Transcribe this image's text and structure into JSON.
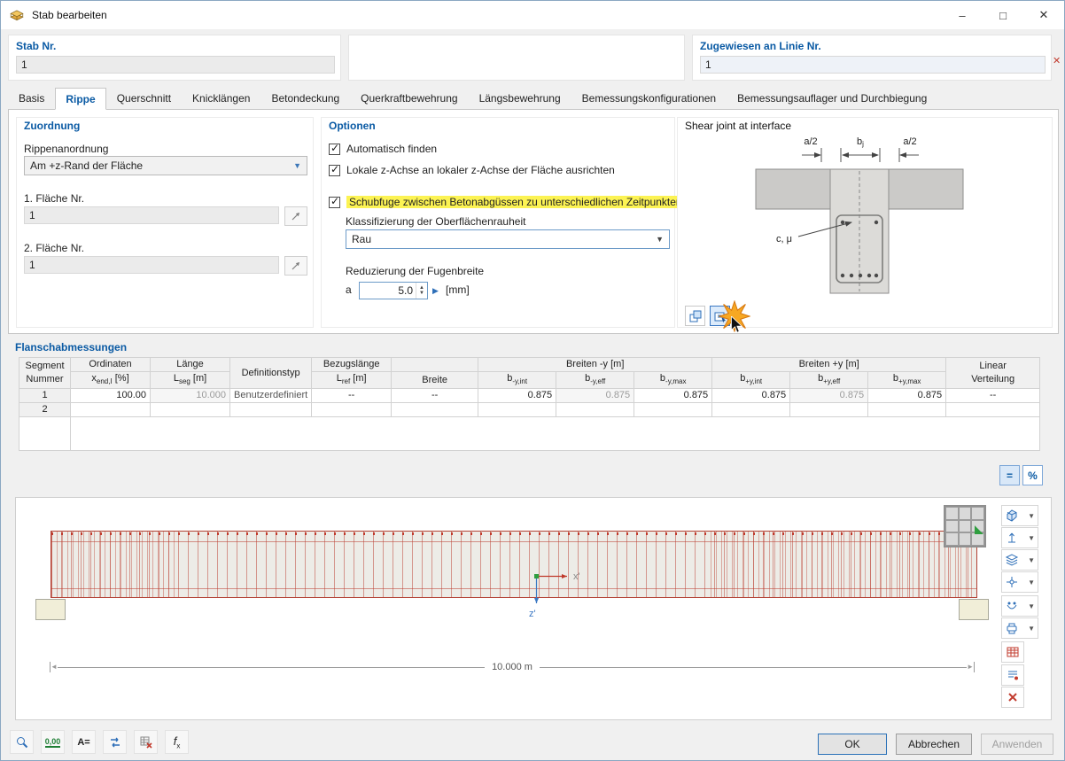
{
  "window": {
    "title": "Stab bearbeiten"
  },
  "header": {
    "stab_label": "Stab Nr.",
    "stab_value": "1",
    "line_label": "Zugewiesen an Linie Nr.",
    "line_value": "1"
  },
  "tabs": {
    "t0": "Basis",
    "t1": "Rippe",
    "t2": "Querschnitt",
    "t3": "Knicklängen",
    "t4": "Betondeckung",
    "t5": "Querkraftbewehrung",
    "t6": "Längsbewehrung",
    "t7": "Bemessungskonfigurationen",
    "t8": "Bemessungsauflager und Durchbiegung"
  },
  "zuordnung": {
    "title": "Zuordnung",
    "anordnung_label": "Rippenanordnung",
    "anordnung_value": "Am +z-Rand der Fläche",
    "f1_label": "1. Fläche Nr.",
    "f1_value": "1",
    "f2_label": "2. Fläche Nr.",
    "f2_value": "1"
  },
  "optionen": {
    "title": "Optionen",
    "cb1": "Automatisch finden",
    "cb2": "Lokale z-Achse an lokaler z-Achse der Fläche ausrichten",
    "cb3": "Schubfuge zwischen Betonabgüssen zu unterschiedlichen Zeitpunkten",
    "rough_label": "Klassifizierung der Oberflächenrauheit",
    "rough_value": "Rau",
    "reduction_label": "Reduzierung der Fugenbreite",
    "a_label": "a",
    "a_value": "5.0",
    "a_unit": "[mm]"
  },
  "diagram": {
    "title": "Shear joint at interface",
    "dim_a_left": "a/2",
    "dim_b_main": "b",
    "dim_b_sub": "j",
    "dim_a_right": "a/2",
    "c_label": "c, μ"
  },
  "flansch": {
    "title": "Flanschabmessungen",
    "h_segment1": "Segment",
    "h_segment2": "Nummer",
    "h_ord_top": "Ordinaten",
    "h_ord_main": "x",
    "h_ord_sub": "end,I",
    "h_ord_unit": " [%]",
    "h_len_top": "Länge",
    "h_len_main": "L",
    "h_len_sub": "seg",
    "h_len_unit": " [m]",
    "h_def": "Definitionstyp",
    "h_ref_top": "Bezugslänge",
    "h_ref_main": "L",
    "h_ref_sub": "ref",
    "h_ref_unit": " [m]",
    "h_breite": "Breite",
    "h_group_minus": "Breiten -y [m]",
    "h_group_plus": "Breiten +y [m]",
    "h_b_main": "b",
    "h_bm_int": "-y,int",
    "h_bm_eff": "-y,eff",
    "h_bm_max": "-y,max",
    "h_bp_int": "+y,int",
    "h_bp_eff": "+y,eff",
    "h_bp_max": "+y,max",
    "h_lin1": "Linear",
    "h_lin2": "Verteilung",
    "rows": [
      {
        "nr": "1",
        "ord": "100.00",
        "len": "10.000",
        "def": "Benutzerdefiniert",
        "ref": "--",
        "breite": "--",
        "bm_int": "0.875",
        "bm_eff": "0.875",
        "bm_max": "0.875",
        "bp_int": "0.875",
        "bp_eff": "0.875",
        "bp_max": "0.875",
        "lin": "--"
      },
      {
        "nr": "2",
        "ord": "",
        "len": "",
        "def": "",
        "ref": "",
        "breite": "",
        "bm_int": "",
        "bm_eff": "",
        "bm_max": "",
        "bp_int": "",
        "bp_eff": "",
        "bp_max": "",
        "lin": ""
      }
    ],
    "btn_equals": "=",
    "btn_percent": "%"
  },
  "viewport": {
    "dim_label": "10.000 m",
    "axis_x": "x'",
    "axis_z": "z'"
  },
  "toolbar": {
    "units_text": "0,00",
    "annotate_text": "A=",
    "formula_main": "f",
    "formula_sub": "x"
  },
  "footer": {
    "ok": "OK",
    "cancel": "Abbrechen",
    "apply": "Anwenden"
  },
  "colors": {
    "accent_blue": "#0a5aa4",
    "highlight_yellow": "#fcf353",
    "mesh_red": "#c0392b"
  }
}
